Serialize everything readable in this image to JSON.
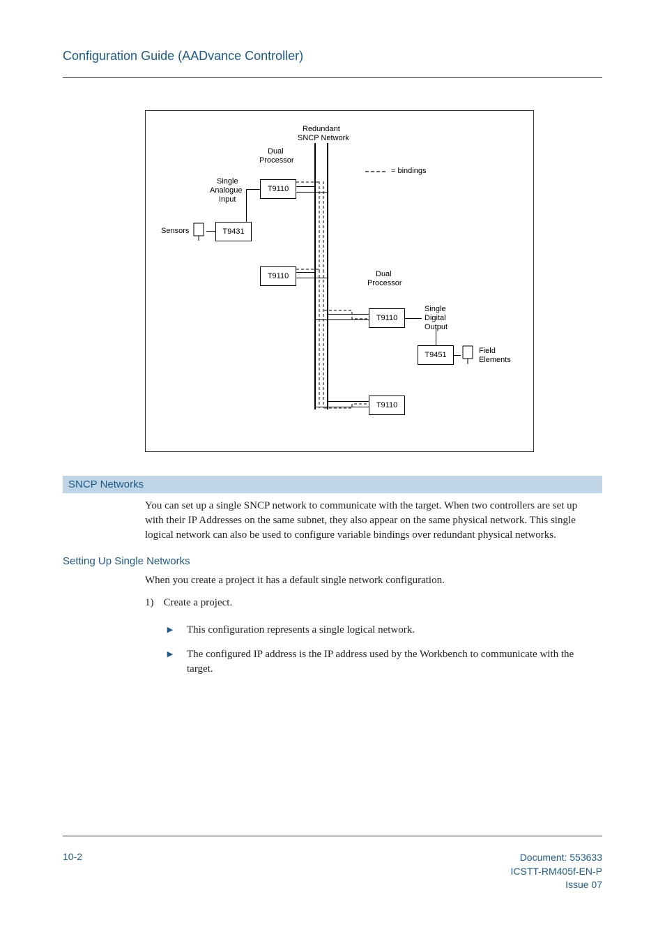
{
  "header": {
    "title": "Configuration Guide (AADvance Controller)"
  },
  "diagram": {
    "top_label1": "Redundant",
    "top_label2": "SNCP Network",
    "dual_proc": "Dual",
    "processor": "Processor",
    "single": "Single",
    "analogue": "Analogue",
    "input": "Input",
    "sensors": "Sensors",
    "t9110": "T9110",
    "t9431": "T9431",
    "t9451": "T9451",
    "bindings_key": "= bindings",
    "digital": "Digital",
    "output": "Output",
    "field": "Field",
    "elements": "Elements"
  },
  "section": {
    "heading": "SNCP Networks",
    "para": "You can set up a single SNCP network to communicate with the target. When two controllers are set up with their IP Addresses on the same subnet, they also appear on the same physical network. This single logical network can also be used to configure variable bindings over redundant physical networks."
  },
  "sub": {
    "heading": "Setting Up Single Networks",
    "intro": "When you create a project it has a default single network configuration.",
    "step_num": "1)",
    "step_text": "Create a project.",
    "bullet1": "This configuration represents a single logical network.",
    "bullet2": "The configured IP address is the IP address used by the Workbench to communicate with the target."
  },
  "footer": {
    "page_num": "10-2",
    "doc_line1": "Document: 553633",
    "doc_line2": "ICSTT-RM405f-EN-P",
    "doc_line3": "Issue 07"
  }
}
